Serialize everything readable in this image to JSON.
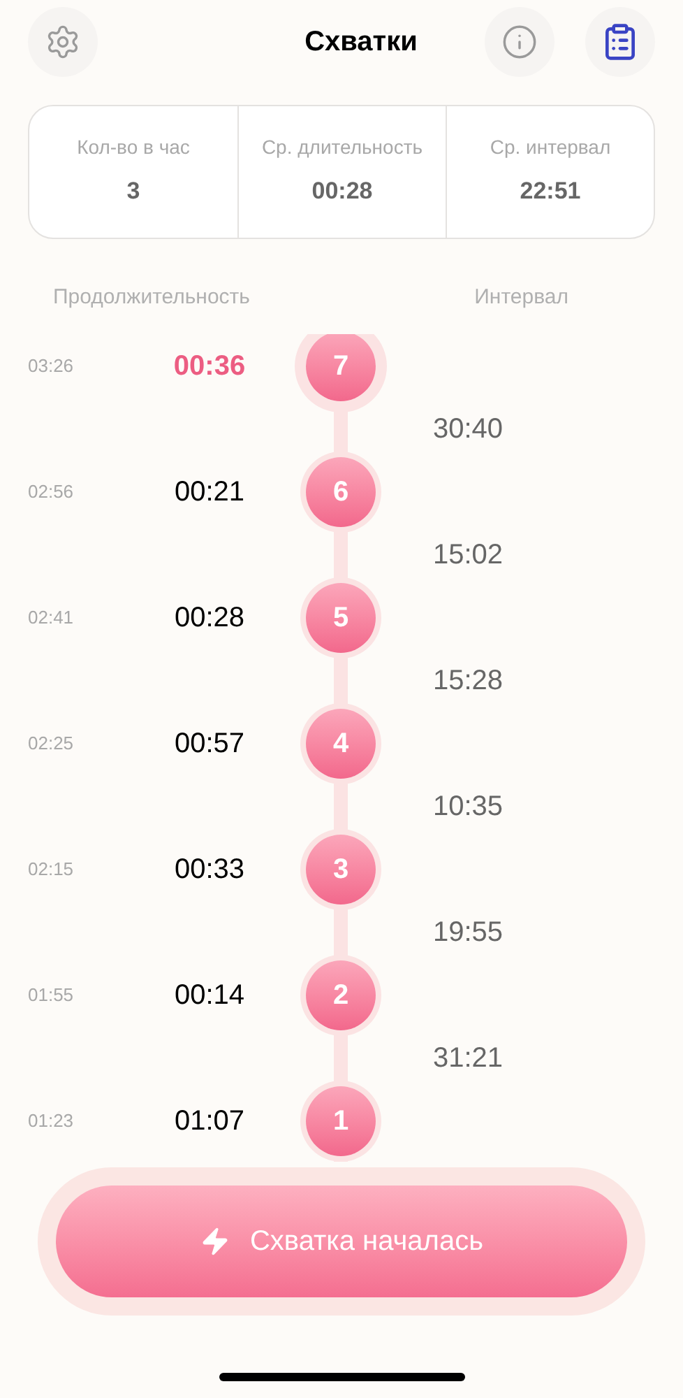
{
  "header": {
    "title": "Схватки"
  },
  "stats": [
    {
      "label": "Кол-во в час",
      "value": "3"
    },
    {
      "label": "Ср. длительность",
      "value": "00:28"
    },
    {
      "label": "Ср. интервал",
      "value": "22:51"
    }
  ],
  "columns": {
    "duration": "Продолжительность",
    "interval": "Интервал"
  },
  "contractions": [
    {
      "number": "7",
      "start": "03:26",
      "duration": "00:36",
      "selected": true,
      "interval_after": "30:40"
    },
    {
      "number": "6",
      "start": "02:56",
      "duration": "00:21",
      "selected": false,
      "interval_after": "15:02"
    },
    {
      "number": "5",
      "start": "02:41",
      "duration": "00:28",
      "selected": false,
      "interval_after": "15:28"
    },
    {
      "number": "4",
      "start": "02:25",
      "duration": "00:57",
      "selected": false,
      "interval_after": "10:35"
    },
    {
      "number": "3",
      "start": "02:15",
      "duration": "00:33",
      "selected": false,
      "interval_after": "19:55"
    },
    {
      "number": "2",
      "start": "01:55",
      "duration": "00:14",
      "selected": false,
      "interval_after": "31:21"
    },
    {
      "number": "1",
      "start": "01:23",
      "duration": "01:07",
      "selected": false
    }
  ],
  "start_button": {
    "label": "Схватка началась"
  }
}
